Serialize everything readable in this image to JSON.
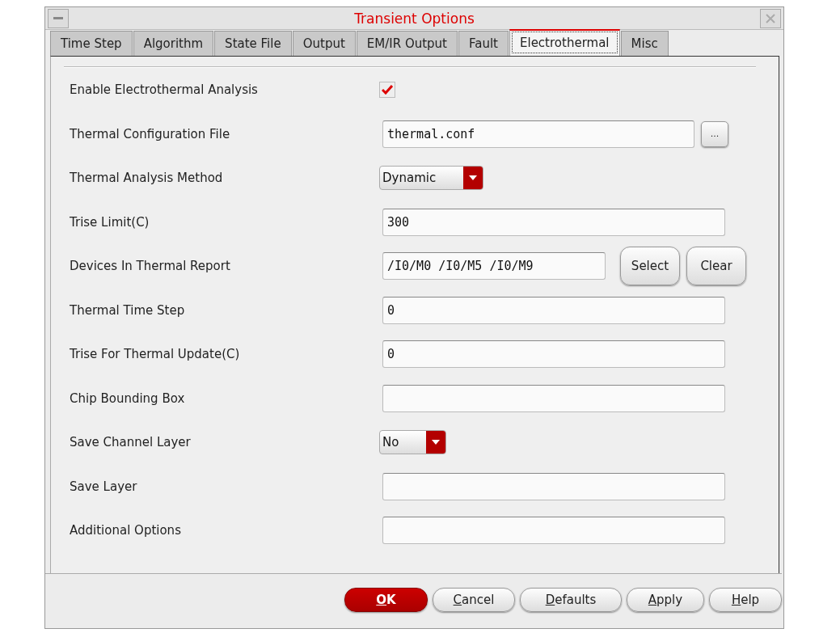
{
  "window": {
    "title": "Transient Options"
  },
  "tabs": [
    {
      "label": "Time Step",
      "selected": false
    },
    {
      "label": "Algorithm",
      "selected": false
    },
    {
      "label": "State File",
      "selected": false
    },
    {
      "label": "Output",
      "selected": false
    },
    {
      "label": "EM/IR Output",
      "selected": false
    },
    {
      "label": "Fault",
      "selected": false
    },
    {
      "label": "Electrothermal",
      "selected": true
    },
    {
      "label": "Misc",
      "selected": false
    }
  ],
  "fields": [
    {
      "kind": "checkbox",
      "label": "Enable Electrothermal Analysis",
      "checked": true
    },
    {
      "kind": "file",
      "label": "Thermal Configuration File",
      "value": "thermal.conf",
      "button": "..."
    },
    {
      "kind": "dropdown",
      "label": "Thermal Analysis Method",
      "value": "Dynamic"
    },
    {
      "kind": "text",
      "label": "Trise Limit(C)",
      "value": "300"
    },
    {
      "kind": "select",
      "label": "Devices In Thermal Report",
      "value": "/I0/M0 /I0/M5 /I0/M9",
      "buttons": [
        "Select",
        "Clear"
      ]
    },
    {
      "kind": "text",
      "label": "Thermal Time Step",
      "value": "0"
    },
    {
      "kind": "text",
      "label": "Trise For Thermal Update(C)",
      "value": "0"
    },
    {
      "kind": "text",
      "label": "Chip Bounding Box"
    },
    {
      "kind": "dropdown",
      "label": "Save Channel Layer",
      "value": "No"
    },
    {
      "kind": "text",
      "label": "Save Layer"
    },
    {
      "kind": "text",
      "label": "Additional Options"
    }
  ],
  "buttons": [
    {
      "label": "OK",
      "kind": "default"
    },
    {
      "label": "Cancel",
      "kind": "normal"
    },
    {
      "label": "Defaults",
      "kind": "normal"
    },
    {
      "label": "Apply",
      "kind": "normal"
    },
    {
      "label": "Help",
      "kind": "normal"
    }
  ]
}
